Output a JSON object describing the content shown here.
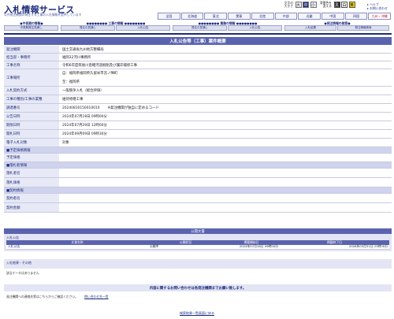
{
  "header": {
    "title": "入札情報サービス",
    "subtitle": "公共発注機関の発注する工事の入札情報を提供しています",
    "font_size_label": "文字の大きさ",
    "font_sizes": [
      "大",
      "中",
      "小"
    ],
    "color_label": "背景色を変える",
    "colors": [
      "黒",
      "白",
      "黄"
    ],
    "help_links": [
      "ヘルプ",
      "お問い合わせ"
    ]
  },
  "regions": [
    "全国",
    "北海道",
    "東北",
    "関東",
    "北陸",
    "中部",
    "近畿",
    "中国",
    "四国",
    "九州・沖縄"
  ],
  "category_nav": [
    {
      "head": "中長期の情報",
      "subs": [
        "中長期発注見通し"
      ]
    },
    {
      "head": "工事の情報",
      "subs": [
        "発注の見通し",
        "入札公告"
      ]
    },
    {
      "head": "業務の情報",
      "subs": [
        "発注の見通し",
        "入札公告"
      ]
    },
    {
      "head": "発注情報の検索",
      "subs": [
        "入札結果",
        "発注情報検索"
      ]
    }
  ],
  "detail": {
    "title": "入札公告等（工事）案件概要",
    "rows": [
      {
        "label": "発注機関",
        "value": "国土交通省九州地方整備局"
      },
      {
        "label": "担当部・事務所",
        "value": "福岡32河川事務所"
      },
      {
        "label": "工事名称",
        "value": "令和6年度筑後川直轄河道掘削及び護岸補修工事"
      },
      {
        "label": "工事場所",
        "value": "自：福岡県福岡県久留米市宮ノ陣町"
      },
      {
        "label": "",
        "value": "至：福岡県"
      },
      {
        "label": "入札契約方式",
        "value": "一般競争入札（総合評価）"
      },
      {
        "label": "工事の種別/工事の業種",
        "value": "維持修繕工事"
      },
      {
        "label": "調達番号",
        "value": "20240810150010010"
      },
      {
        "label": "公告日時",
        "value": "2024年07月18日 09時00分"
      },
      {
        "label": "期限日時",
        "value": "2024年07月29日 12時00分"
      },
      {
        "label": "開札日時",
        "value": "2024年09月09日 09時30分"
      },
      {
        "label": "電子入札対象",
        "value": "対象"
      }
    ],
    "order_note": "※発注機関が独自に定めるコード",
    "sections": {
      "estimated": "■予定価格情報",
      "winner": "■落札者情報",
      "contract": "■契約情報"
    },
    "estimated_rows": [
      {
        "label": "予定価格",
        "value": ""
      }
    ],
    "winner_rows": [
      {
        "label": "落札者名",
        "value": ""
      },
      {
        "label": "落札価格",
        "value": ""
      }
    ],
    "contract_rows": [
      {
        "label": "契約者名",
        "value": ""
      },
      {
        "label": "契約金額",
        "value": ""
      }
    ]
  },
  "public_docs": {
    "title": "公開文書",
    "sub_title": "入札公告",
    "columns": [
      "文書名称",
      "公開状況",
      "掲載開始日",
      "掲載終了日"
    ],
    "rows": [
      {
        "name": "入札公告",
        "status": "公開中",
        "start": "2024年07月18日 09時00分",
        "end": "2026年03月31日 23時00分"
      }
    ],
    "other_title": "入札結果・その他",
    "other_note": "該当データはありません"
  },
  "inquiry": {
    "band": "内容に関するお問い合わせは各発注機関までお願い致します。",
    "label": "発注機関への連絡先等はこちらからご確認ください。",
    "link": "問い合わせ先一覧"
  },
  "back_link": "検索結果一覧画面に戻る"
}
